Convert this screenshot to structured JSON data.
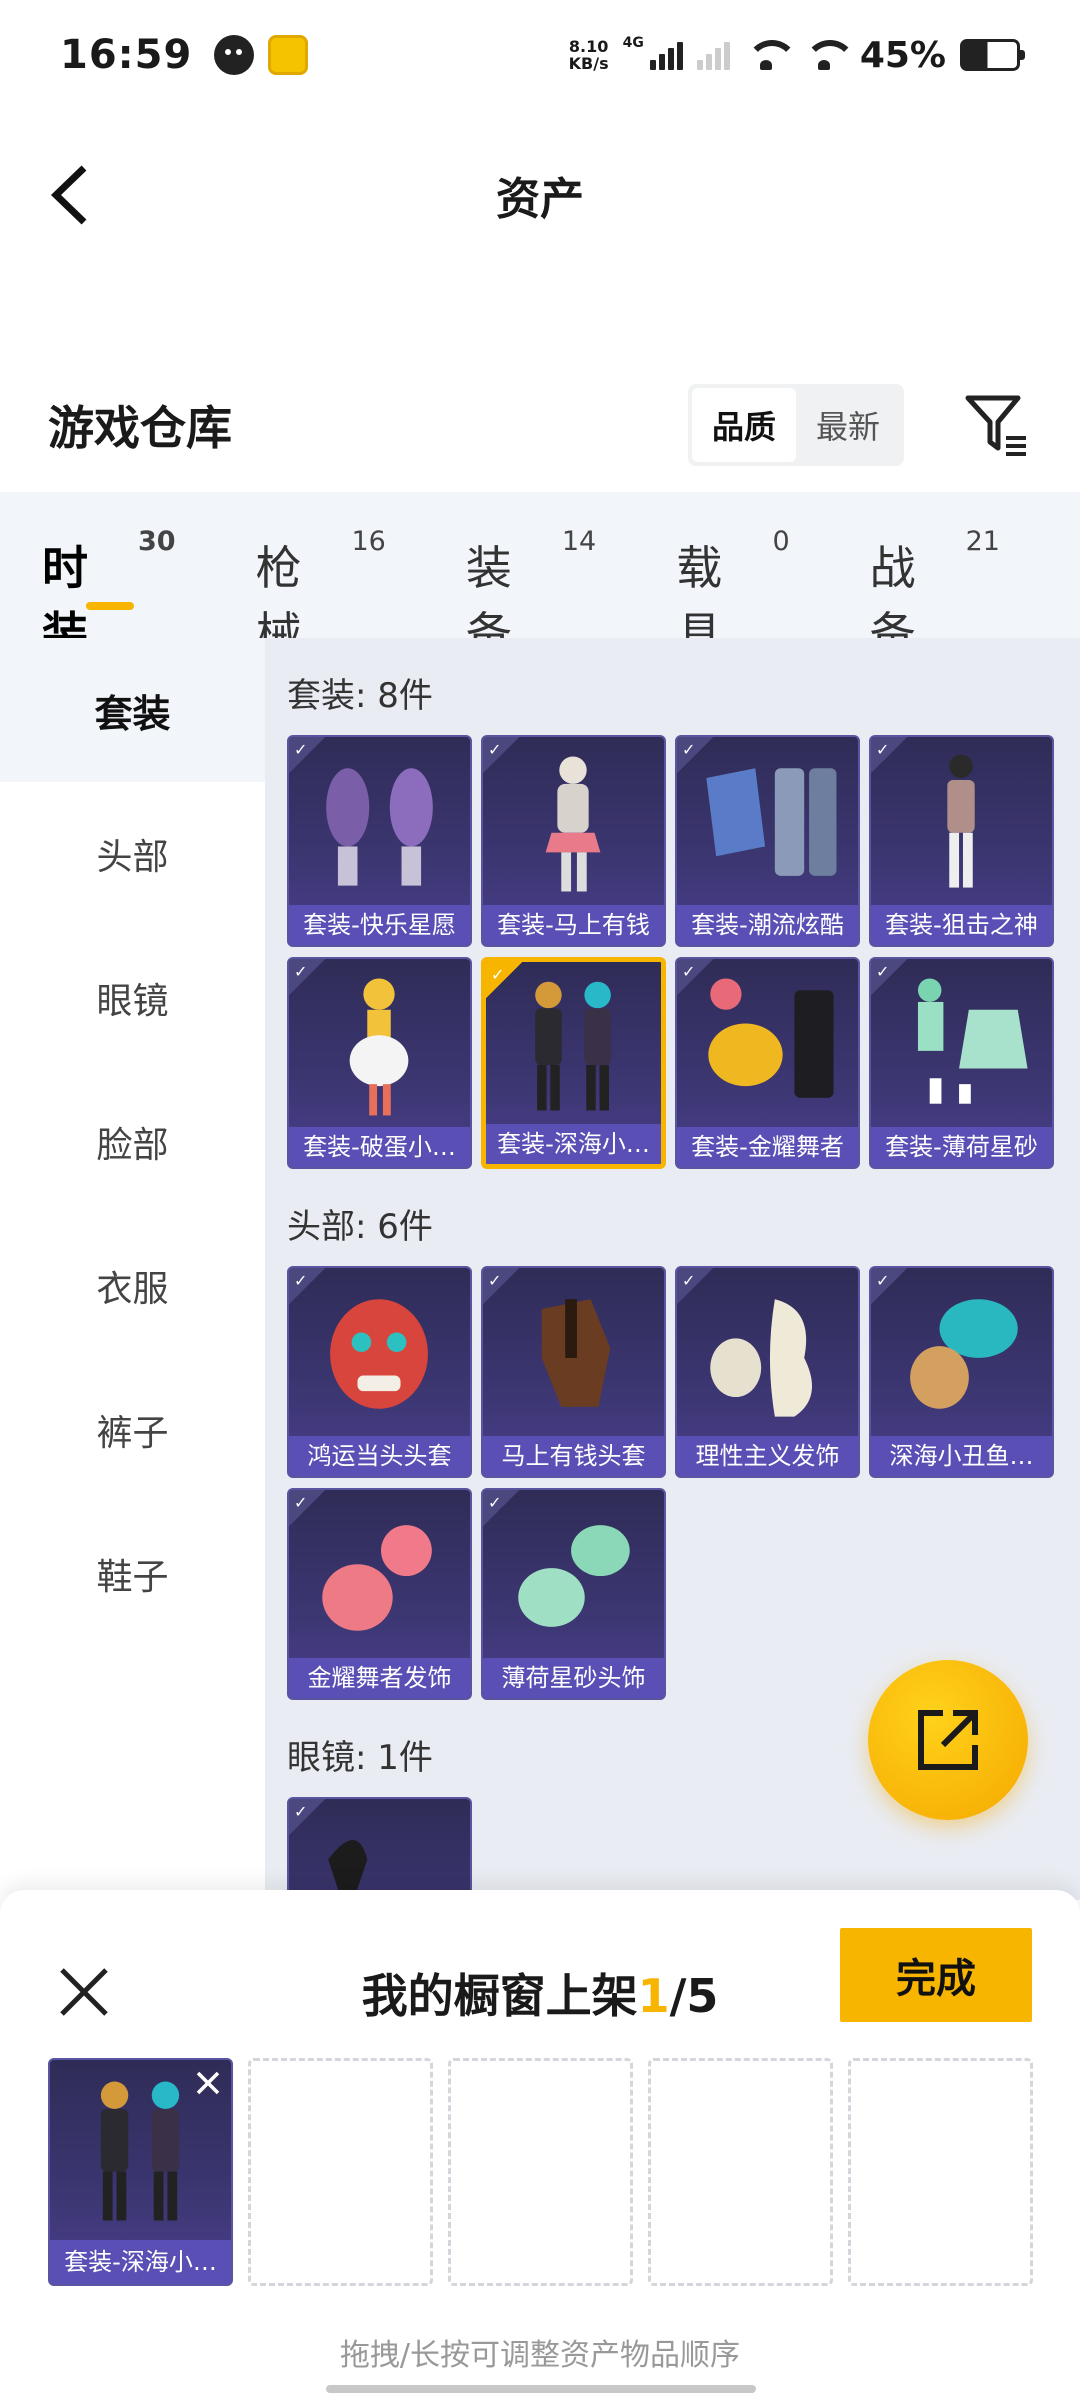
{
  "status_bar": {
    "time": "16:59",
    "speed_value": "8.10",
    "speed_unit": "KB/s",
    "network": "4G",
    "battery": "45%"
  },
  "header": {
    "title": "资产"
  },
  "warehouse": {
    "title": "游戏仓库",
    "sort_options": [
      "品质",
      "最新"
    ],
    "sort_selected": "品质"
  },
  "tabs": [
    {
      "label": "时装",
      "count": "30"
    },
    {
      "label": "枪械",
      "count": "16"
    },
    {
      "label": "装备",
      "count": "14"
    },
    {
      "label": "载具",
      "count": "0"
    },
    {
      "label": "战备",
      "count": "21"
    }
  ],
  "sidebar": [
    "套装",
    "头部",
    "眼镜",
    "脸部",
    "衣服",
    "裤子",
    "鞋子"
  ],
  "sections": {
    "suits": {
      "title": "套装: 8件",
      "items": [
        "套装-快乐星愿",
        "套装-马上有钱",
        "套装-潮流炫酷",
        "套装-狙击之神",
        "套装-破蛋小…",
        "套装-深海小…",
        "套装-金耀舞者",
        "套装-薄荷星砂"
      ]
    },
    "head": {
      "title": "头部: 6件",
      "items": [
        "鸿运当头头套",
        "马上有钱头套",
        "理性主义发饰",
        "深海小丑鱼…",
        "金耀舞者发饰",
        "薄荷星砂头饰"
      ]
    },
    "glasses": {
      "title": "眼镜: 1件"
    }
  },
  "showcase": {
    "title_prefix": "我的橱窗上架",
    "current": "1",
    "total": "/5",
    "done_label": "完成",
    "slot_item": "套装-深海小…",
    "hint": "拖拽/长按可调整资产物品顺序"
  },
  "colors": {
    "accent": "#f7b500",
    "card_bg": "#3c3672",
    "card_label": "#5a4fb5"
  }
}
